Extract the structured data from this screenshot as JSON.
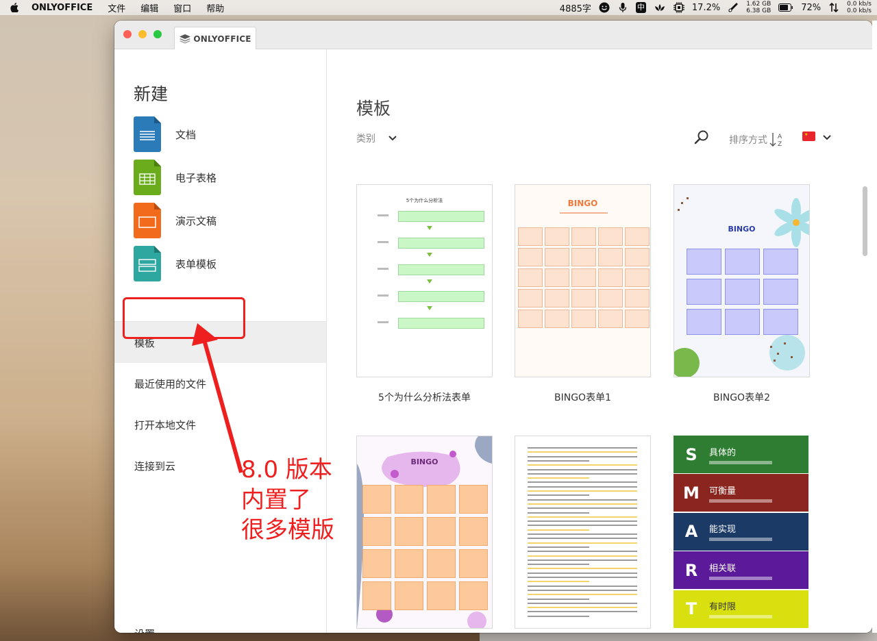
{
  "menubar": {
    "app_name": "ONLYOFFICE",
    "menus": [
      "文件",
      "编辑",
      "窗口",
      "帮助"
    ],
    "word_count": "4885字",
    "input_method": "中",
    "cpu": "17.2%",
    "mem_used": "1.62 GB",
    "mem_total": "6.38 GB",
    "battery": "72%",
    "net_up": "0.0 kb/s",
    "net_down": "0.0 kb/s"
  },
  "window": {
    "tab_label": "ONLYOFFICE"
  },
  "sidebar": {
    "title": "新建",
    "new_items": [
      {
        "label": "文档",
        "color": "#2b7bb9",
        "icon": "document-icon"
      },
      {
        "label": "电子表格",
        "color": "#6aac1c",
        "icon": "spreadsheet-icon"
      },
      {
        "label": "演示文稿",
        "color": "#f26b1d",
        "icon": "presentation-icon"
      },
      {
        "label": "表单模板",
        "color": "#2ea7a0",
        "icon": "form-template-icon"
      }
    ],
    "nav": [
      {
        "label": "模板",
        "active": true
      },
      {
        "label": "最近使用的文件",
        "active": false
      },
      {
        "label": "打开本地文件",
        "active": false
      },
      {
        "label": "连接到云",
        "active": false
      }
    ],
    "settings_label": "设置"
  },
  "main": {
    "title": "模板",
    "category_label": "类别",
    "sort_label": "排序方式",
    "templates": [
      {
        "label": "5个为什么分析法表单",
        "thumb_title": "5个为什么分析法"
      },
      {
        "label": "BINGO表单1",
        "thumb_title": "BINGO"
      },
      {
        "label": "BINGO表单2",
        "thumb_title": "BINGO"
      },
      {
        "label": "",
        "thumb_title": "BINGO"
      },
      {
        "label": "",
        "thumb_title": ""
      },
      {
        "label": "",
        "thumb_title": ""
      }
    ],
    "smart": [
      {
        "letter": "S",
        "title": "具体的",
        "color": "#2e7d32"
      },
      {
        "letter": "M",
        "title": "可衡量",
        "color": "#8b2520"
      },
      {
        "letter": "A",
        "title": "能实现",
        "color": "#1c3a66"
      },
      {
        "letter": "R",
        "title": "相关联",
        "color": "#5a1a9a"
      },
      {
        "letter": "T",
        "title": "有时限",
        "color": "#d9e010"
      }
    ]
  },
  "annotation": {
    "lines": [
      "8.0 版本",
      "内置了",
      "很多模版"
    ],
    "color": "#ee1f1f"
  }
}
